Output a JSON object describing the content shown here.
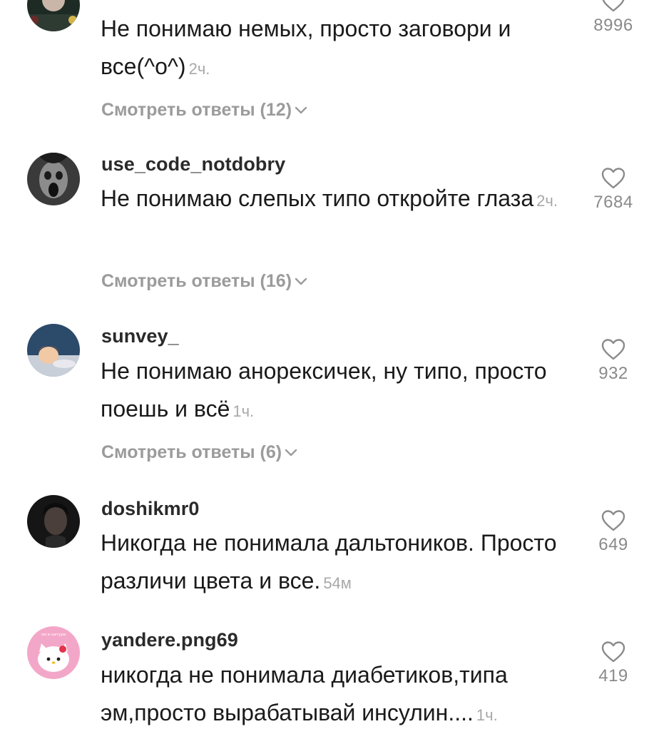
{
  "comments": [
    {
      "text": "Не понимаю немых, просто заговори и все(^o^)",
      "time": "2ч.",
      "replies_label": "Смотреть ответы (12)",
      "likes": "8996",
      "avatar_icon": "dark-portrait-avatar"
    },
    {
      "username": "use_code_notdobry",
      "text": "Не понимаю слепых типо откройте глаза",
      "time": "2ч.",
      "replies_label": "Смотреть ответы (16)",
      "likes": "7684",
      "avatar_icon": "screaming-face-avatar"
    },
    {
      "username": "sunvey_",
      "text": "Не понимаю анорексичек, ну типо, просто поешь и всё",
      "time": "1ч.",
      "replies_label": "Смотреть ответы (6)",
      "likes": "932",
      "avatar_icon": "cartoon-girl-avatar"
    },
    {
      "username": "doshikmr0",
      "text": "Никогда не понимала дальтоников. Просто различи цвета и все.",
      "time": "54м",
      "likes": "649",
      "avatar_icon": "dark-profile-avatar"
    },
    {
      "username": "yandere.png69",
      "avatar_caption": "эм в натуре",
      "text": "никогда не понимала диабетиков,типа эм,просто вырабатывай инсулин....",
      "time": "1ч.",
      "likes": "419",
      "avatar_icon": "hello-kitty-avatar"
    }
  ],
  "icons": {
    "like": "heart-outline-icon",
    "expand": "chevron-down-icon"
  },
  "colors": {
    "text": "#1a1a1a",
    "muted": "#9b9b9b",
    "background": "#ffffff"
  }
}
